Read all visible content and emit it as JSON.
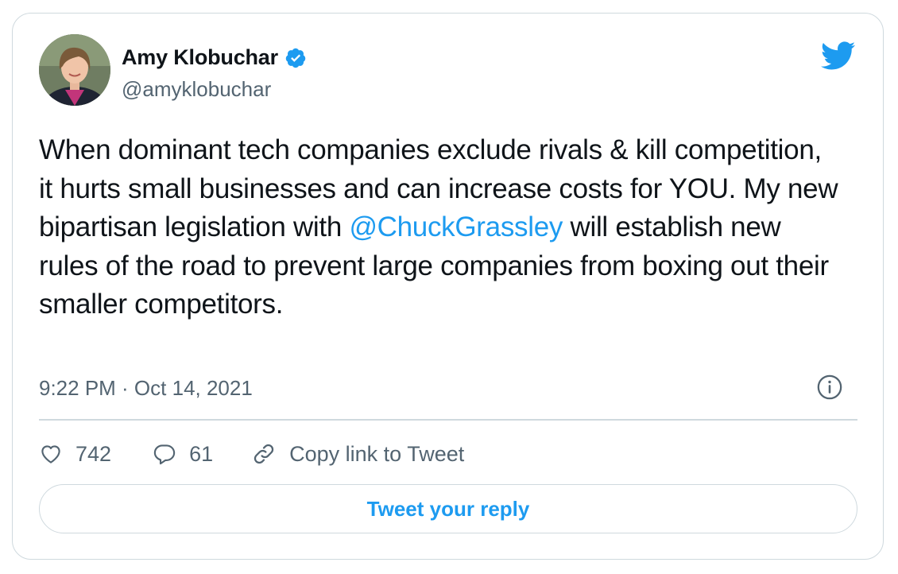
{
  "tweet": {
    "author": {
      "display_name": "Amy Klobuchar",
      "handle": "@amyklobuchar",
      "verified": true
    },
    "text_segments": {
      "before_mention": "When dominant tech companies exclude rivals & kill competition, it hurts small businesses and can increase costs for YOU. My new bipartisan legislation with ",
      "mention": "@ChuckGrassley",
      "after_mention": " will establish new rules of the road to prevent large companies from boxing out their smaller competitors."
    },
    "timestamp": "9:22 PM · Oct 14, 2021",
    "actions": {
      "likes": "742",
      "replies": "61",
      "copy_link_label": "Copy link to Tweet"
    },
    "reply_button_label": "Tweet your reply"
  },
  "colors": {
    "accent": "#1d9bf0",
    "text_primary": "#0f1419",
    "text_secondary": "#536471",
    "border": "#cfd9de"
  },
  "icons": {
    "brand": "twitter-bird-icon",
    "verified": "verified-badge-icon",
    "info": "info-icon",
    "like": "heart-icon",
    "reply": "speech-bubble-icon",
    "copy_link": "link-icon"
  }
}
